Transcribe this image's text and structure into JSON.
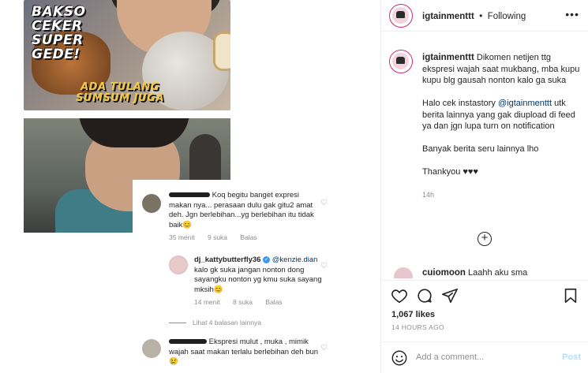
{
  "image": {
    "title_caption": "BAKSO CEKER SUPER GEDE!",
    "sub_caption": "ADA TULANG SUMSUM JUGA"
  },
  "comments": [
    {
      "user": "",
      "text": "Koq begitu banget expresi makan nya... perasaan dulu gak gitu2 amat deh. Jgn berlebihan...yg berlebihan itu tidak baik😊",
      "time": "35 menit",
      "likes": "9 suka",
      "reply": "Balas"
    },
    {
      "user": "dj_kattybutterfly36",
      "mention": "@kenzie.dian",
      "text": "kalo gk suka jangan nonton dong sayangku nonton yg kmu suka sayang mksih😊",
      "time": "14 menit",
      "likes": "8 suka",
      "reply": "Balas"
    },
    {
      "view_replies": "Lihat 4 balasan lainnya"
    },
    {
      "user": "",
      "text": "Ekspresi mulut , muka , mimik wajah saat makan terlalu berlebihan deh bun😢"
    }
  ],
  "sidebar": {
    "username": "igtainmenttt",
    "separator": "•",
    "following": "Following",
    "caption_user": "igtainmenttt",
    "caption_1": "Dikomen netijen ttg ekspresi wajah saat mukbang, mba kupu kupu blg gausah nonton kalo ga suka",
    "caption_2_pre": "Halo cek instastory ",
    "caption_2_mention": "@igtainmenttt",
    "caption_2_post": " utk berita lainnya yang gak diupload di feed ya dan jgn lupa turn on notification",
    "caption_3": "Banyak berita seru lainnya lho",
    "caption_4": "Thankyou ♥♥♥",
    "caption_time": "14h",
    "peek_user": "cuiomoon",
    "peek_text": "Laahh aku sma",
    "likes": "1,067 likes",
    "post_time": "14 HOURS AGO",
    "add_comment_placeholder": "Add a comment...",
    "post_label": "Post"
  }
}
